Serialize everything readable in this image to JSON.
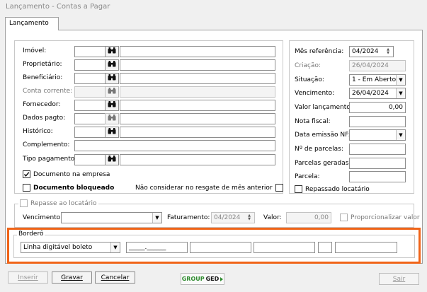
{
  "window": {
    "title": "Lançamento - Contas a Pagar"
  },
  "tabs": [
    {
      "label": "Lançamento"
    }
  ],
  "left_form": {
    "fields": [
      {
        "label": "Imóvel:",
        "enabled": true
      },
      {
        "label": "Proprietário:",
        "enabled": true
      },
      {
        "label": "Beneficiário:",
        "enabled": true
      },
      {
        "label": "Conta corrente:",
        "enabled": false
      },
      {
        "label": "Fornecedor:",
        "enabled": true
      },
      {
        "label": "Dados pagto:",
        "enabled": true
      },
      {
        "label": "Histórico:",
        "enabled": true
      },
      {
        "label": "Complemento:",
        "enabled": true
      },
      {
        "label": "Tipo pagamento:",
        "enabled": true
      }
    ],
    "documento_empresa": {
      "label": "Documento na empresa",
      "checked": true
    },
    "documento_bloqueado": {
      "label": "Documento bloqueado",
      "checked": false
    },
    "nao_considerar": {
      "label": "Não considerar no resgate de mês anterior",
      "checked": false
    }
  },
  "right_form": {
    "mes_referencia": {
      "label": "Mês referência:",
      "value": "04/2024"
    },
    "criacao": {
      "label": "Criação:",
      "value": "26/04/2024"
    },
    "situacao": {
      "label": "Situação:",
      "value": "1 - Em Aberto"
    },
    "vencimento": {
      "label": "Vencimento:",
      "value": "26/04/2024"
    },
    "valor_lancamento": {
      "label": "Valor lançamento:",
      "value": "0,00"
    },
    "nota_fiscal": {
      "label": "Nota fiscal:",
      "value": ""
    },
    "data_emissao_nf": {
      "label": "Data emissão NF:",
      "value": ""
    },
    "num_parcelas": {
      "label": "Nº de parcelas:",
      "value": ""
    },
    "parcelas_geradas": {
      "label": "Parcelas geradas:",
      "value": ""
    },
    "parcela": {
      "label": "Parcela:",
      "value": ""
    },
    "repassado_locatario": {
      "label": "Repassado locatário",
      "checked": false
    }
  },
  "repasse": {
    "legend": "Repasse ao locatário",
    "checked": false,
    "vencimento_label": "Vencimento:",
    "faturamento_label": "Faturamento:",
    "faturamento_value": "04/2024",
    "valor_label": "Valor:",
    "valor_value": "0,00",
    "proporcionalizar_label": "Proporcionalizar valor"
  },
  "bordero": {
    "legend": "Borderô",
    "tipo_value": "Linha digitável boleto",
    "mask_value": "_____.______"
  },
  "buttons": {
    "inserir": "Inserir",
    "gravar": "Gravar",
    "cancelar": "Cancelar",
    "sair": "Sair"
  },
  "logo": {
    "text_group": "GROUP",
    "text_ged": "GED",
    "color_green": "#2e8b2e"
  },
  "colors": {
    "highlight": "#f06418"
  }
}
